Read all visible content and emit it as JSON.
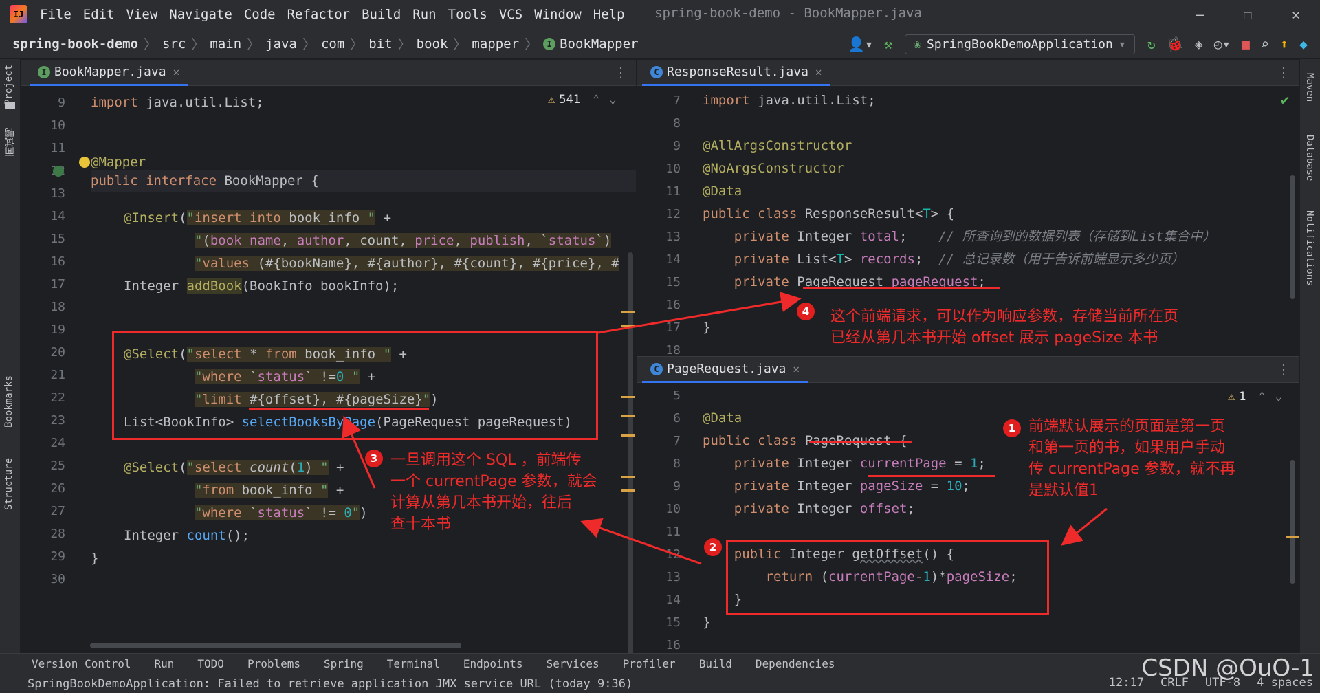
{
  "window": {
    "title": "spring-book-demo - BookMapper.java",
    "menu": [
      "File",
      "Edit",
      "View",
      "Navigate",
      "Code",
      "Refactor",
      "Build",
      "Run",
      "Tools",
      "VCS",
      "Window",
      "Help"
    ],
    "controls": [
      "—",
      "❐",
      "✕"
    ]
  },
  "breadcrumb": [
    "spring-book-demo",
    "src",
    "main",
    "java",
    "com",
    "bit",
    "book",
    "mapper",
    "BookMapper"
  ],
  "toolbar": {
    "run_config": "SpringBookDemoApplication"
  },
  "left_strip": {
    "project": "Project",
    "cn": "面试鸭",
    "bookmarks": "Bookmarks",
    "structure": "Structure"
  },
  "right_strip": {
    "maven": "Maven",
    "database": "Database",
    "notifications": "Notifications"
  },
  "left_editor": {
    "tab": "BookMapper.java",
    "warnings": "541",
    "lines": [
      {
        "n": "9"
      },
      {
        "n": "10"
      },
      {
        "n": "11"
      },
      {
        "n": "12"
      },
      {
        "n": "13"
      },
      {
        "n": "14"
      },
      {
        "n": "15"
      },
      {
        "n": "16"
      },
      {
        "n": "17"
      },
      {
        "n": "18"
      },
      {
        "n": "19"
      },
      {
        "n": "20"
      },
      {
        "n": "21"
      },
      {
        "n": "22"
      },
      {
        "n": "23"
      },
      {
        "n": "24"
      },
      {
        "n": "25"
      },
      {
        "n": "26"
      },
      {
        "n": "27"
      },
      {
        "n": "28"
      },
      {
        "n": "29"
      },
      {
        "n": "30"
      }
    ]
  },
  "right_top_editor": {
    "tab": "ResponseResult.java",
    "lines": [
      {
        "n": "7"
      },
      {
        "n": "8"
      },
      {
        "n": "9"
      },
      {
        "n": "10"
      },
      {
        "n": "11"
      },
      {
        "n": "12"
      },
      {
        "n": "13"
      },
      {
        "n": "14"
      },
      {
        "n": "15"
      },
      {
        "n": "16"
      },
      {
        "n": "17"
      },
      {
        "n": "18"
      }
    ]
  },
  "right_bottom_editor": {
    "tab": "PageRequest.java",
    "warnings": "1",
    "lines": [
      {
        "n": "5"
      },
      {
        "n": "6"
      },
      {
        "n": "7"
      },
      {
        "n": "8"
      },
      {
        "n": "9"
      },
      {
        "n": "10"
      },
      {
        "n": "11"
      },
      {
        "n": "12"
      },
      {
        "n": "13"
      },
      {
        "n": "14"
      },
      {
        "n": "15"
      },
      {
        "n": "16"
      }
    ]
  },
  "annotations": {
    "b1": "1",
    "b2": "2",
    "b3": "3",
    "b4": "4",
    "note1": [
      "前端默认展示的页面是第一页",
      "和第一页的书，如果用户手动",
      "传 currentPage 参数，就不再",
      "是默认值1"
    ],
    "note3": [
      "一旦调用这个 SQL ，前端传",
      "一个 currentPage 参数，就会",
      "计算从第几本书开始，往后",
      "查十本书"
    ],
    "note4": [
      "这个前端请求，可以作为响应参数，存储当前所在页",
      "已经从第几本书开始 offset 展示 pageSize 本书"
    ]
  },
  "tool_windows": [
    "Version Control",
    "Run",
    "TODO",
    "Problems",
    "Spring",
    "Terminal",
    "Endpoints",
    "Services",
    "Profiler",
    "Build",
    "Dependencies"
  ],
  "status": {
    "message": "SpringBookDemoApplication: Failed to retrieve application JMX service URL (today 9:36)",
    "position": "12:17",
    "line_sep": "CRLF",
    "encoding": "UTF-8",
    "indent": "4 spaces"
  },
  "watermark": "CSDN @OuO-1"
}
